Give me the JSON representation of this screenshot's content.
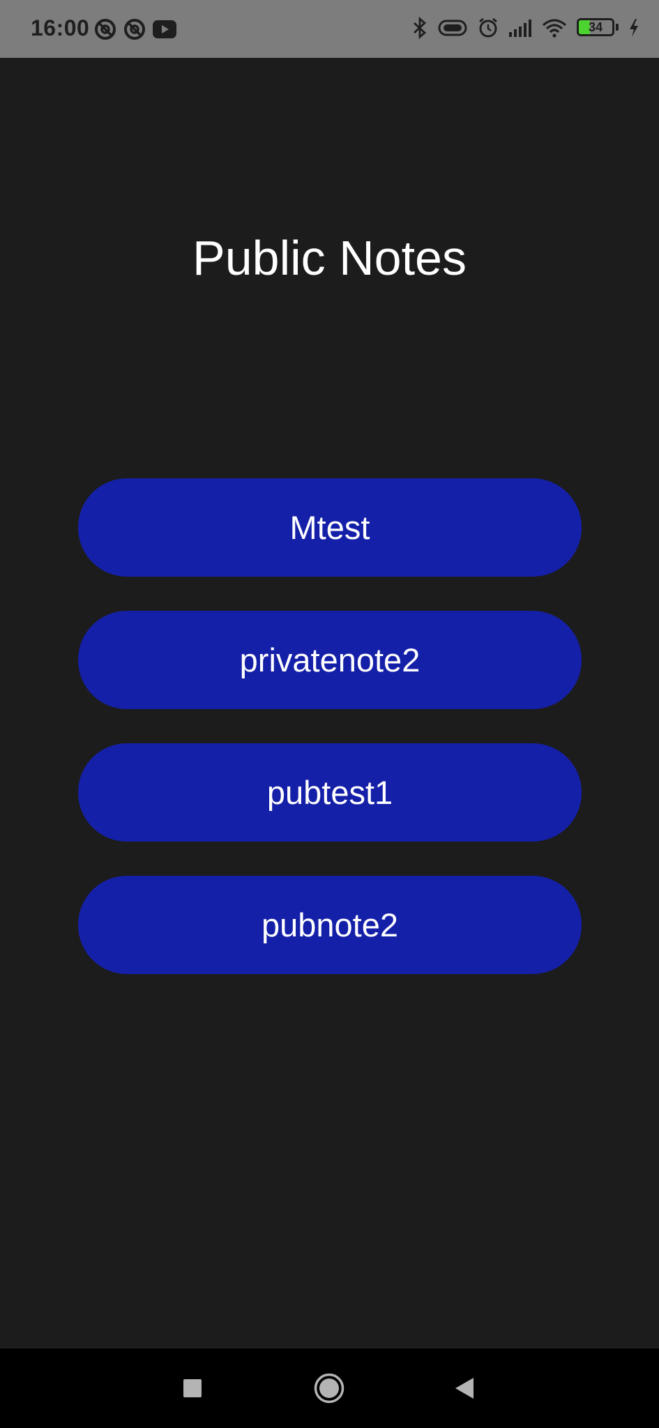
{
  "status_bar": {
    "time": "16:00",
    "left_icons": [
      "do-not-disturb-icon",
      "do-not-disturb-icon",
      "youtube-icon"
    ],
    "right_icons": [
      "bluetooth-icon",
      "vibrate-icon",
      "alarm-icon",
      "signal-icon",
      "wifi-icon",
      "battery-icon",
      "charging-icon"
    ],
    "battery_level": "34",
    "battery_fraction": 0.34
  },
  "page": {
    "title": "Public Notes"
  },
  "notes": [
    {
      "label": "Mtest"
    },
    {
      "label": "privatenote2"
    },
    {
      "label": "pubtest1"
    },
    {
      "label": "pubnote2"
    }
  ],
  "colors": {
    "background": "#1c1c1c",
    "status_bar": "#7d7d7d",
    "button": "#1520a8",
    "text": "#ffffff",
    "battery_fill": "#4cd32f"
  },
  "nav_bar": {
    "buttons": [
      "recents-icon",
      "home-icon",
      "back-icon"
    ]
  }
}
